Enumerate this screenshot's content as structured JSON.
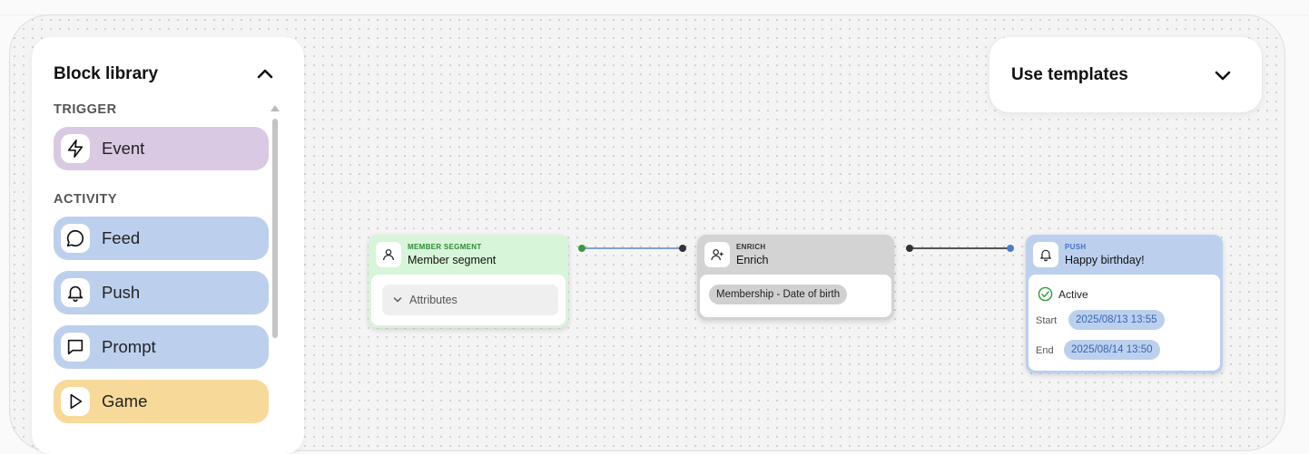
{
  "library": {
    "title": "Block library",
    "sections": {
      "trigger": "TRIGGER",
      "activity": "ACTIVITY"
    },
    "items": [
      {
        "label": "Event",
        "icon": "lightning-icon",
        "color": "#d9c9e3"
      },
      {
        "label": "Feed",
        "icon": "chat-bubble-icon",
        "color": "#bcd0ee"
      },
      {
        "label": "Push",
        "icon": "bell-icon",
        "color": "#bcd0ee"
      },
      {
        "label": "Prompt",
        "icon": "message-square-icon",
        "color": "#bcd0ee"
      },
      {
        "label": "Game",
        "icon": "play-icon",
        "color": "#f7d99a"
      }
    ]
  },
  "templates": {
    "title": "Use templates"
  },
  "nodes": {
    "segment": {
      "kicker": "MEMBER SEGMENT",
      "title": "Member segment",
      "attributes_label": "Attributes",
      "color": "#d7f5d8",
      "kicker_color": "#2e8b36"
    },
    "enrich": {
      "kicker": "ENRICH",
      "title": "Enrich",
      "chip": "Membership - Date of birth",
      "color": "#d3d3d3"
    },
    "push": {
      "kicker": "PUSH",
      "title": "Happy birthday!",
      "status": "Active",
      "start_label": "Start",
      "start_value": "2025/08/13 13:55",
      "end_label": "End",
      "end_value": "2025/08/14 13:50",
      "color": "#bcd0ee",
      "kicker_color": "#3f73c4"
    }
  },
  "colors": {
    "accent_blue": "#5b8fd6",
    "active_green": "#2e9b3c",
    "line_dark": "#444444"
  }
}
